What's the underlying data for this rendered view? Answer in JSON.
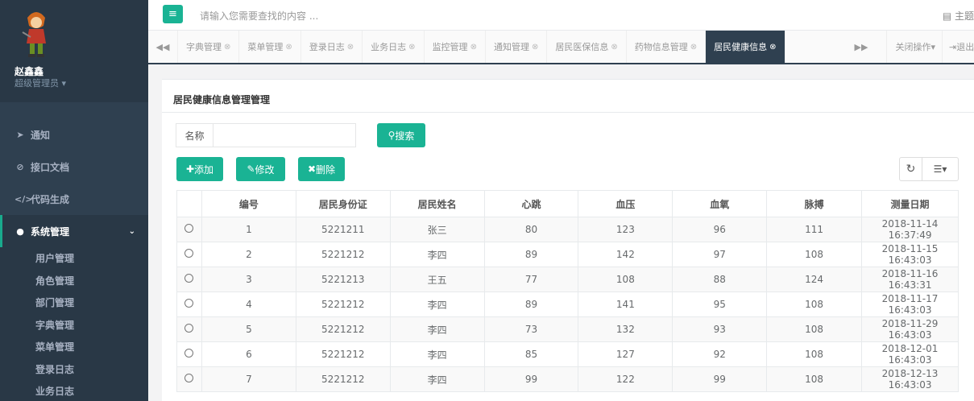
{
  "topbar": {
    "search_placeholder": "请输入您需要查找的内容 ...",
    "theme_label": "主题"
  },
  "user": {
    "name": "赵鑫鑫",
    "role": "超级管理员"
  },
  "nav": [
    {
      "label": "通知",
      "icon": "paper-plane-icon"
    },
    {
      "label": "接口文档",
      "icon": "link-icon"
    },
    {
      "label": "代码生成",
      "icon": "code-icon"
    }
  ],
  "nav_system": {
    "label": "系统管理",
    "icon": "user-icon"
  },
  "sub_items": [
    "用户管理",
    "角色管理",
    "部门管理",
    "字典管理",
    "菜单管理",
    "登录日志",
    "业务日志"
  ],
  "tabs": [
    "字典管理",
    "菜单管理",
    "登录日志",
    "业务日志",
    "监控管理",
    "通知管理",
    "居民医保信息",
    "药物信息管理",
    "居民健康信息"
  ],
  "tab_ops": {
    "close_label": "关闭操作",
    "logout_label": "退出"
  },
  "panel": {
    "title": "居民健康信息管理管理"
  },
  "search": {
    "label": "名称",
    "value": "",
    "button": "搜索"
  },
  "toolbar": {
    "add": "添加",
    "edit": "修改",
    "delete": "删除"
  },
  "table": {
    "columns": [
      "编号",
      "居民身份证",
      "居民姓名",
      "心跳",
      "血压",
      "血氧",
      "脉搏",
      "测量日期"
    ],
    "rows": [
      [
        "1",
        "5221211",
        "张三",
        "80",
        "123",
        "96",
        "111",
        "2018-11-14 16:37:49"
      ],
      [
        "2",
        "5221212",
        "李四",
        "89",
        "142",
        "97",
        "108",
        "2018-11-15 16:43:03"
      ],
      [
        "3",
        "5221213",
        "王五",
        "77",
        "108",
        "88",
        "124",
        "2018-11-16 16:43:31"
      ],
      [
        "4",
        "5221212",
        "李四",
        "89",
        "141",
        "95",
        "108",
        "2018-11-17 16:43:03"
      ],
      [
        "5",
        "5221212",
        "李四",
        "73",
        "132",
        "93",
        "108",
        "2018-11-29 16:43:03"
      ],
      [
        "6",
        "5221212",
        "李四",
        "85",
        "127",
        "92",
        "108",
        "2018-12-01 16:43:03"
      ],
      [
        "7",
        "5221212",
        "李四",
        "99",
        "122",
        "99",
        "108",
        "2018-12-13 16:43:03"
      ]
    ]
  },
  "colors": {
    "accent": "#1ab394",
    "sidebar": "#2f4050",
    "sidebar_dark": "#293846"
  }
}
